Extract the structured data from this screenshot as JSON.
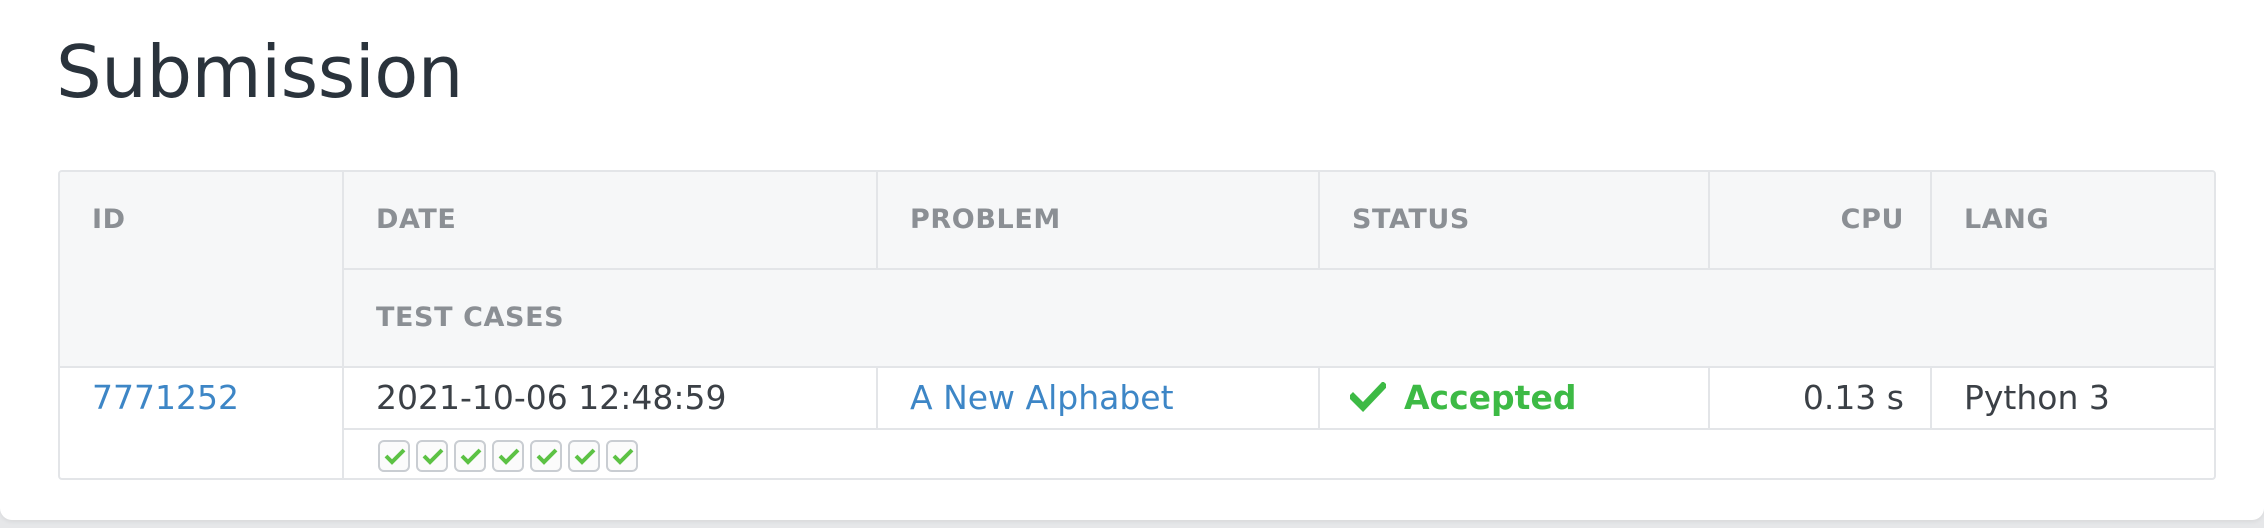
{
  "page": {
    "title": "Submission"
  },
  "table": {
    "headers": {
      "id": "ID",
      "date": "DATE",
      "problem": "PROBLEM",
      "status": "STATUS",
      "cpu": "CPU",
      "lang": "LANG",
      "test_cases": "TEST CASES"
    },
    "row": {
      "id": "7771252",
      "date": "2021-10-06 12:48:59",
      "problem": "A New Alphabet",
      "status": "Accepted",
      "cpu": "0.13 s",
      "lang": "Python 3",
      "test_cases_passed": 7,
      "test_cases_total": 7
    }
  },
  "colors": {
    "accent_link": "#3d86c6",
    "status_accepted": "#3dba45",
    "title_text": "#2a333c",
    "header_text": "#8b8f94"
  },
  "icons": {
    "status": "check-icon",
    "test_case": "check-icon"
  }
}
